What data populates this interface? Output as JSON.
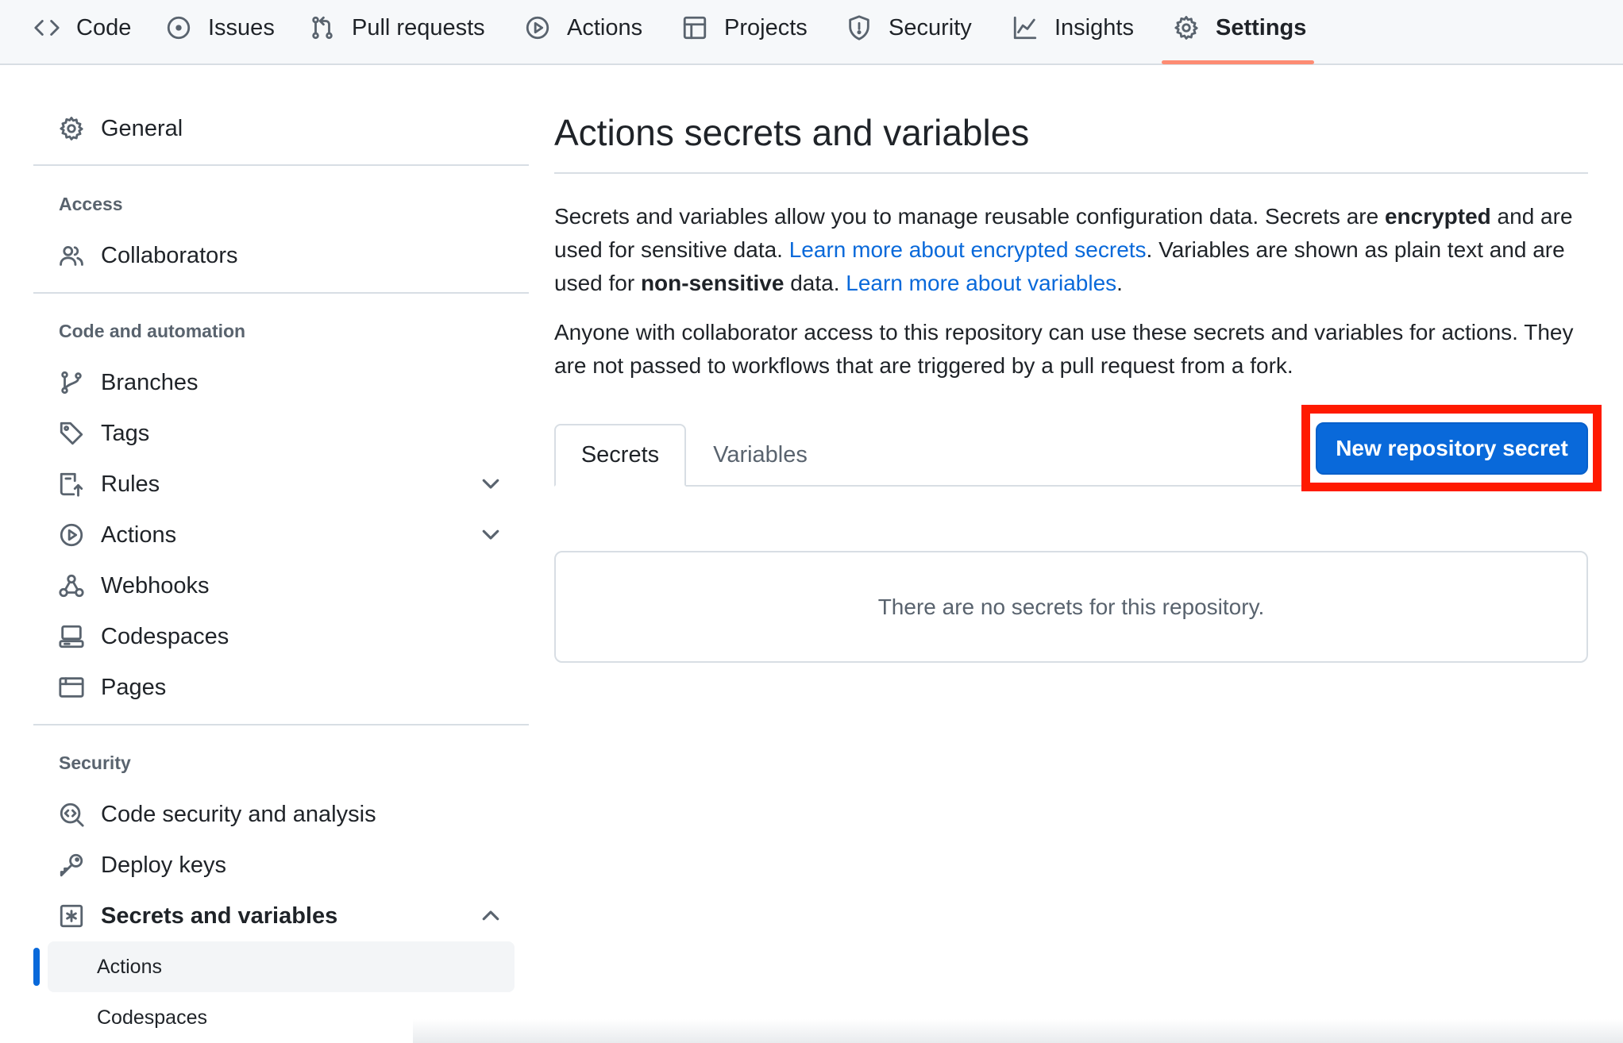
{
  "topnav": {
    "tabs": [
      {
        "label": "Code",
        "icon": "code-icon"
      },
      {
        "label": "Issues",
        "icon": "issue-opened-icon"
      },
      {
        "label": "Pull requests",
        "icon": "git-pull-request-icon"
      },
      {
        "label": "Actions",
        "icon": "play-icon"
      },
      {
        "label": "Projects",
        "icon": "table-icon"
      },
      {
        "label": "Security",
        "icon": "shield-icon"
      },
      {
        "label": "Insights",
        "icon": "graph-icon"
      },
      {
        "label": "Settings",
        "icon": "gear-icon",
        "selected": true
      }
    ],
    "underline_color": "#fd8c73"
  },
  "sidebar": {
    "general": "General",
    "access_heading": "Access",
    "collaborators": "Collaborators",
    "code_heading": "Code and automation",
    "branches": "Branches",
    "tags": "Tags",
    "rules": "Rules",
    "actions": "Actions",
    "webhooks": "Webhooks",
    "codespaces": "Codespaces",
    "pages": "Pages",
    "security_heading": "Security",
    "code_security": "Code security and analysis",
    "deploy_keys": "Deploy keys",
    "secrets_vars": "Secrets and variables",
    "sub_actions": "Actions",
    "sub_codespaces": "Codespaces"
  },
  "main": {
    "title": "Actions secrets and variables",
    "p1": {
      "a": "Secrets and variables allow you to manage reusable configuration data. Secrets are ",
      "b_encrypted": "encrypted",
      "c": " and are used for sensitive data. ",
      "link1": "Learn more about encrypted secrets",
      "d": ". Variables are shown as plain text and are used for ",
      "b_nonsensitive": "non-sensitive",
      "e": " data. ",
      "link2": "Learn more about variables",
      "f": "."
    },
    "p2": "Anyone with collaborator access to this repository can use these secrets and variables for actions. They are not passed to workflows that are triggered by a pull request from a fork.",
    "tab_secrets": "Secrets",
    "tab_variables": "Variables",
    "new_secret_button": "New repository secret",
    "empty_message": "There are no secrets for this repository."
  },
  "colors": {
    "accent": "#0969da",
    "highlight": "#ff1a00",
    "border": "#d8dee4",
    "muted": "#59636e"
  }
}
